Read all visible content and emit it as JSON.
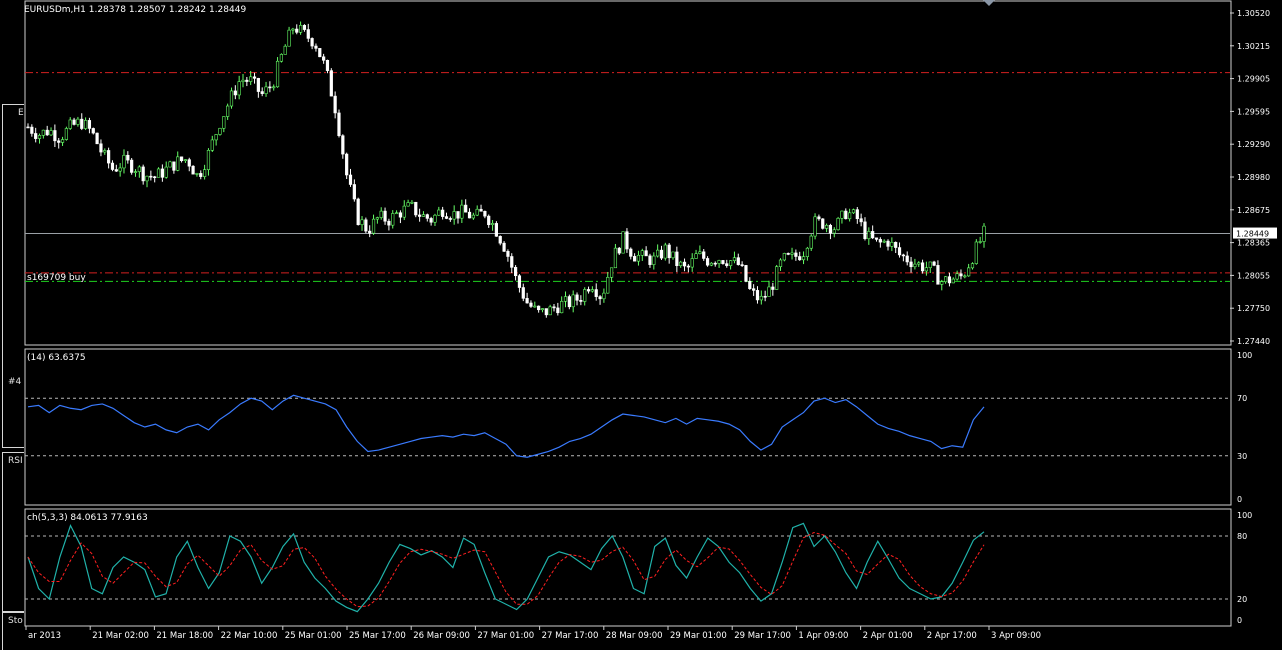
{
  "window": {
    "symbol_header": "EURUSDm,H1  1.28378 1.28507 1.28242 1.28449",
    "current_price_tag": "1.28449",
    "order_label": "s169709 buy"
  },
  "left_panel": {
    "labels": [
      "E",
      "#4",
      "RSI",
      "Sto"
    ]
  },
  "colors": {
    "background": "#000000",
    "bull_candle": "#66ff66",
    "bear_candle": "#ffffff",
    "rsi_line": "#3a7bff",
    "stoch_main": "#20b2aa",
    "stoch_signal": "#ff2020",
    "level_red": "#d42020",
    "level_green": "#1fd11f",
    "price_line": "#9aa0a6"
  },
  "panes": {
    "rsi": {
      "header": "(14) 63.6375",
      "levels": [
        "100",
        "70",
        "30",
        "0"
      ]
    },
    "stoch": {
      "header": "ch(5,3,3) 84.0613 77.9163",
      "levels": [
        "100",
        "80",
        "20",
        "0"
      ]
    }
  },
  "price_axis": [
    "1.30520",
    "1.30215",
    "1.29905",
    "1.29595",
    "1.29290",
    "1.28980",
    "1.28675",
    "1.28365",
    "1.28055",
    "1.27750",
    "1.27440"
  ],
  "time_axis": [
    "ar 2013",
    "21 Mar 02:00",
    "21 Mar 18:00",
    "22 Mar 10:00",
    "25 Mar 01:00",
    "25 Mar 17:00",
    "26 Mar 09:00",
    "27 Mar 01:00",
    "27 Mar 17:00",
    "28 Mar 09:00",
    "29 Mar 01:00",
    "29 Mar 17:00",
    "1 Apr 09:00",
    "2 Apr 01:00",
    "2 Apr 17:00",
    "3 Apr 09:00"
  ],
  "chart_data": {
    "type": "candlestick",
    "symbol": "EURUSDm",
    "timeframe": "H1",
    "ylim": [
      1.2744,
      1.3052
    ],
    "last_ohlc": {
      "open": 1.28378,
      "high": 1.28507,
      "low": 1.28242,
      "close": 1.28449
    },
    "horizontal_levels": [
      {
        "value": 1.2996,
        "style": "dash-dot",
        "color": "red"
      },
      {
        "value": 1.2808,
        "style": "dash-dot",
        "color": "red"
      },
      {
        "value": 1.28,
        "style": "dash-dot",
        "color": "green"
      },
      {
        "value": 1.28449,
        "style": "solid",
        "color": "gray"
      }
    ],
    "close_path": [
      1.2945,
      1.2938,
      1.2942,
      1.2935,
      1.2945,
      1.295,
      1.294,
      1.292,
      1.2905,
      1.2912,
      1.2908,
      1.29,
      1.2898,
      1.2905,
      1.2912,
      1.2915,
      1.2898,
      1.292,
      1.2948,
      1.297,
      1.299,
      1.2988,
      1.2975,
      1.2985,
      1.3015,
      1.304,
      1.3032,
      1.3025,
      1.3,
      1.296,
      1.29,
      1.286,
      1.2848,
      1.286,
      1.2858,
      1.2865,
      1.287,
      1.2862,
      1.2858,
      1.2868,
      1.2863,
      1.2865,
      1.286,
      1.2865,
      1.285,
      1.283,
      1.28,
      1.278,
      1.277,
      1.2772,
      1.2778,
      1.278,
      1.2785,
      1.28,
      1.2785,
      1.282,
      1.284,
      1.2825,
      1.2822,
      1.282,
      1.283,
      1.2818,
      1.281,
      1.2825,
      1.282,
      1.2822,
      1.282,
      1.2815,
      1.279,
      1.2782,
      1.2795,
      1.282,
      1.2822,
      1.2828,
      1.2855,
      1.2855,
      1.285,
      1.2865,
      1.286,
      1.2842,
      1.2835,
      1.2838,
      1.2825,
      1.282,
      1.2815,
      1.2812,
      1.28,
      1.2802,
      1.2805,
      1.2825,
      1.2845
    ],
    "rsi": {
      "period": 14,
      "last_value": 63.6375,
      "levels": [
        70,
        30
      ],
      "values": [
        64,
        65,
        60,
        65,
        63,
        62,
        65,
        66,
        63,
        58,
        53,
        50,
        52,
        48,
        46,
        50,
        52,
        48,
        55,
        60,
        66,
        70,
        68,
        62,
        68,
        72,
        70,
        68,
        66,
        62,
        50,
        40,
        33,
        34,
        36,
        38,
        40,
        42,
        43,
        44,
        43,
        45,
        44,
        46,
        42,
        38,
        30,
        29,
        31,
        33,
        36,
        40,
        42,
        45,
        50,
        55,
        59,
        58,
        57,
        55,
        53,
        56,
        52,
        56,
        55,
        54,
        52,
        48,
        40,
        34,
        38,
        50,
        55,
        60,
        68,
        70,
        67,
        69,
        64,
        58,
        52,
        49,
        47,
        44,
        42,
        40,
        35,
        37,
        36,
        55,
        64
      ]
    },
    "stochastic": {
      "params": [
        5,
        3,
        3
      ],
      "main_last": 84.0613,
      "signal_last": 77.9163,
      "levels": [
        80,
        20
      ],
      "main": [
        60,
        30,
        20,
        60,
        90,
        70,
        30,
        25,
        50,
        60,
        55,
        48,
        22,
        25,
        60,
        75,
        50,
        30,
        45,
        80,
        75,
        60,
        35,
        50,
        70,
        82,
        55,
        40,
        30,
        18,
        12,
        8,
        20,
        35,
        55,
        72,
        68,
        62,
        66,
        60,
        50,
        78,
        72,
        45,
        20,
        15,
        10,
        20,
        40,
        60,
        65,
        62,
        55,
        48,
        68,
        80,
        60,
        30,
        25,
        70,
        78,
        52,
        40,
        60,
        78,
        70,
        55,
        45,
        30,
        18,
        25,
        55,
        88,
        92,
        70,
        80,
        65,
        45,
        30,
        55,
        75,
        58,
        40,
        30,
        25,
        20,
        22,
        35,
        55,
        76,
        84
      ]
    }
  }
}
